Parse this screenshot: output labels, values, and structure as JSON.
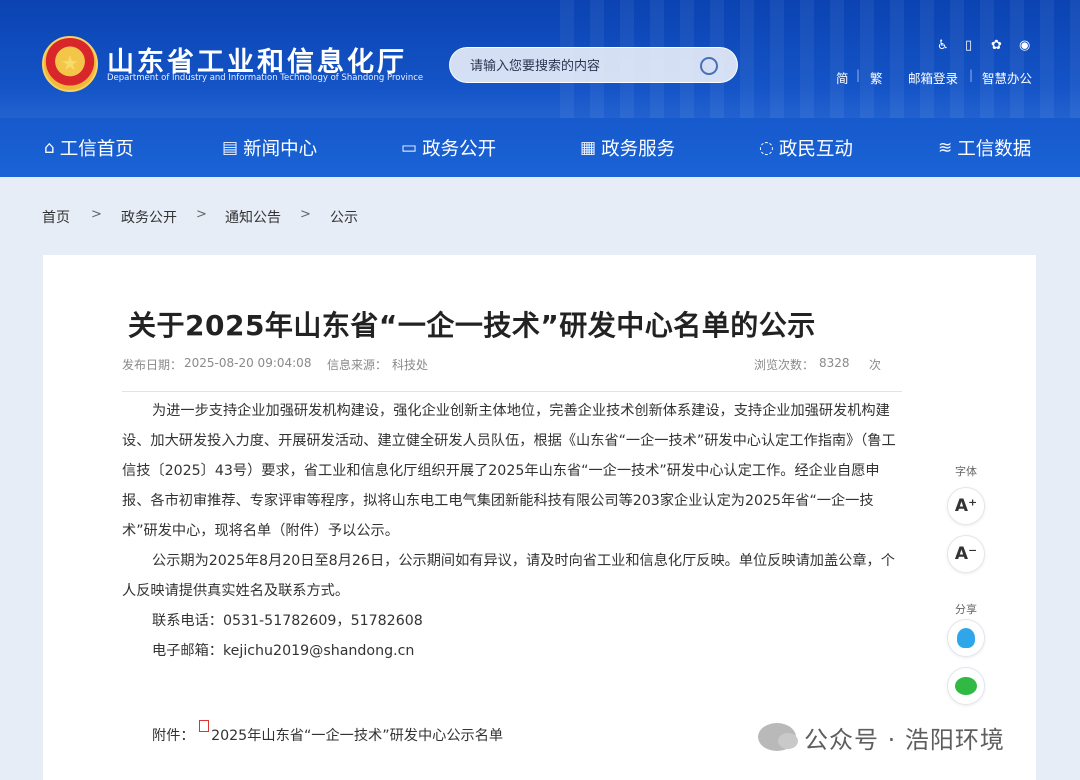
{
  "header": {
    "site_title": "山东省工业和信息化厅",
    "site_subtitle": "Department of Industry and Information Technology of Shandong Province",
    "search_placeholder": "请输入您要搜索的内容",
    "icons": [
      "accessibility-icon",
      "mobile-icon",
      "wechat-icon",
      "weibo-icon"
    ],
    "links": [
      "简",
      "繁",
      "邮箱登录",
      "智慧办公"
    ],
    "colors": {
      "header_bg": "#1556c9",
      "accent": "#0b43b2"
    }
  },
  "nav": {
    "items": [
      {
        "label": "工信首页",
        "icon": "home-icon"
      },
      {
        "label": "新闻中心",
        "icon": "news-icon"
      },
      {
        "label": "政务公开",
        "icon": "monitor-icon"
      },
      {
        "label": "政务服务",
        "icon": "service-icon"
      },
      {
        "label": "政民互动",
        "icon": "chat-icon"
      },
      {
        "label": "工信数据",
        "icon": "database-icon"
      }
    ]
  },
  "breadcrumb": [
    "首页",
    "政务公开",
    "通知公告",
    "公示"
  ],
  "article": {
    "title": "关于2025年山东省“一企一技术”研发中心名单的公示",
    "publish_label": "发布日期：",
    "publish_date": "2025-08-20 09:04:08",
    "source_label": "信息来源：",
    "source": "科技处",
    "views_label": "浏览次数：",
    "views": "8328",
    "views_unit": "次",
    "paragraphs": [
      "为进一步支持企业加强研发机构建设，强化企业创新主体地位，完善企业技术创新体系建设，支持企业加强研发机构建设、加大研发投入力度、开展研发活动、建立健全研发人员队伍，根据《山东省“一企一技术”研发中心认定工作指南》（鲁工信技〔2025〕43号）要求，省工业和信息化厅组织开展了2025年山东省“一企一技术”研发中心认定工作。经企业自愿申报、各市初审推荐、专家评审等程序，拟将山东电工电气集团新能科技有限公司等203家企业认定为2025年省“一企一技术”研发中心，现将名单（附件）予以公示。",
      "公示期为2025年8月20日至8月26日，公示期间如有异议，请及时向省工业和信息化厅反映。单位反映请加盖公章，个人反映请提供真实姓名及联系方式。",
      "联系电话：0531-51782609，51782608",
      "电子邮箱：kejichu2019@shandong.cn"
    ],
    "attachment_label": "附件：",
    "attachment_name": "2025年山东省“一企一技术”研发中心公示名单"
  },
  "side_tools": {
    "font_label": "字体",
    "font_increase": "A⁺",
    "font_decrease": "A⁻",
    "share_label": "分享"
  },
  "watermark": {
    "text": "公众号 · 浩阳环境"
  }
}
